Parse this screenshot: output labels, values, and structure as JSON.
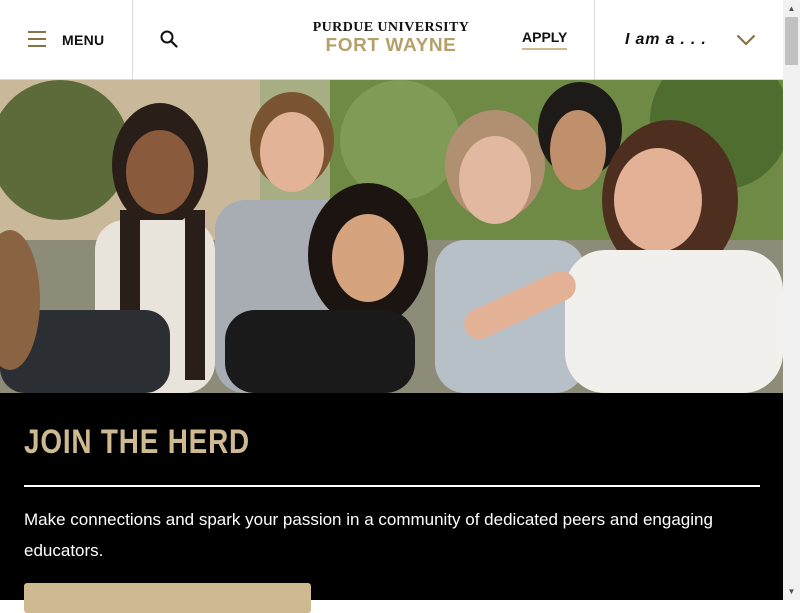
{
  "header": {
    "menu_label": "MENU",
    "logo_line1": "PURDUE UNIVERSITY",
    "logo_line2": "FORT WAYNE",
    "apply_label": "APPLY",
    "iam_label": "I am a . . ."
  },
  "hero": {
    "headline": "JOIN THE HERD",
    "body": "Make connections and spark your passion in a community of dedicated peers and engaging educators."
  },
  "colors": {
    "brand_gold": "#cfb991",
    "logo_gold": "#b5a06a",
    "accent_brown": "#8a7147",
    "band_background": "#000000"
  },
  "icons": [
    "hamburger-icon",
    "search-icon",
    "chevron-down-icon"
  ]
}
